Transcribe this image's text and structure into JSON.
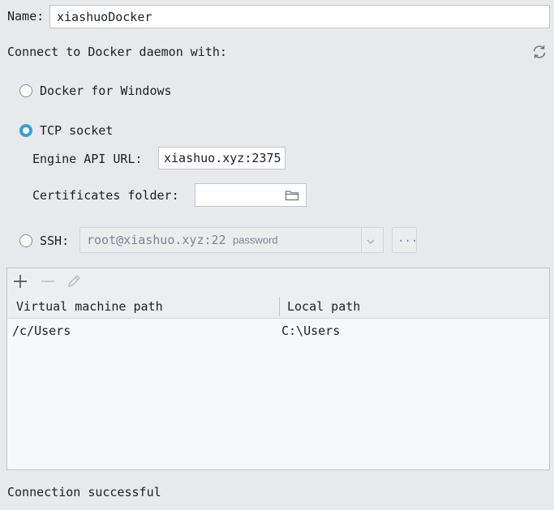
{
  "name": {
    "label": "Name:",
    "value": "xiashuoDocker"
  },
  "connect_heading": "Connect to Docker daemon with:",
  "refresh_icon": "refresh-icon",
  "options": {
    "docker_for_windows": "Docker for Windows",
    "tcp_socket": "TCP socket",
    "ssh": "SSH:"
  },
  "selected_option": "tcp_socket",
  "tcp": {
    "engine_api_label": "Engine API URL:",
    "engine_api_value": "xiashuo.xyz:2375",
    "certificates_label": "Certificates folder:",
    "certificates_value": ""
  },
  "ssh": {
    "config_value": "root@xiashuo.xyz:22",
    "config_auth": "password",
    "more_button": "..."
  },
  "mappings": {
    "toolbar": [
      "add-icon",
      "remove-icon",
      "edit-icon"
    ],
    "columns": [
      "Virtual machine path",
      "Local path"
    ],
    "rows": [
      [
        "/c/Users",
        "C:\\Users"
      ]
    ]
  },
  "status": "Connection successful",
  "colors": {
    "accent": "#3c9fd2",
    "background": "#e8e9ec"
  }
}
